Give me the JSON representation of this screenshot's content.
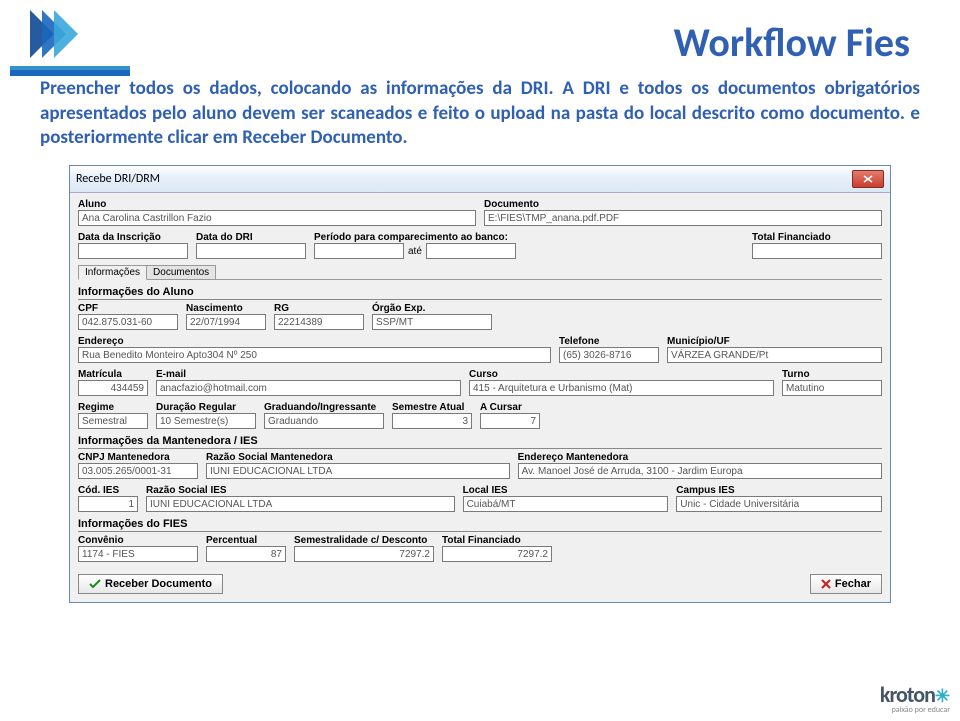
{
  "slide": {
    "title": "Workflow Fies",
    "body_text": "Preencher todos os dados, colocando as informações da DRI. A DRI e todos os documentos obrigatórios apresentados pelo aluno devem ser scaneados e feito o upload na pasta do local descrito como documento. e posteriormente clicar em Receber Documento."
  },
  "window": {
    "title": "Recebe DRI/DRM",
    "close": "X",
    "aluno": {
      "label": "Aluno",
      "value": "Ana Carolina Castrillon Fazio"
    },
    "documento": {
      "label": "Documento",
      "value": "E:\\FIES\\TMP_anana.pdf.PDF"
    },
    "data_inscricao": {
      "label": "Data da Inscrição",
      "value": ""
    },
    "data_dri": {
      "label": "Data do DRI",
      "value": ""
    },
    "periodo": {
      "label": "Período para comparecimento ao banco:",
      "from": "",
      "sep": "até",
      "to": ""
    },
    "total_financiado_top": {
      "label": "Total Financiado",
      "value": ""
    },
    "tabs": [
      "Informações",
      "Documentos"
    ],
    "sec_aluno": {
      "title": "Informações do Aluno",
      "cpf": {
        "label": "CPF",
        "value": "042.875.031-60"
      },
      "nascimento": {
        "label": "Nascimento",
        "value": "22/07/1994"
      },
      "rg": {
        "label": "RG",
        "value": "22214389"
      },
      "orgao": {
        "label": "Órgão Exp.",
        "value": "SSP/MT"
      },
      "endereco": {
        "label": "Endereço",
        "value": "Rua Benedito Monteiro Apto304 Nº 250"
      },
      "telefone": {
        "label": "Telefone",
        "value": "(65) 3026-8716"
      },
      "municipio": {
        "label": "Município/UF",
        "value": "VÁRZEA GRANDE/Pt"
      },
      "matricula": {
        "label": "Matrícula",
        "value": "434459"
      },
      "email": {
        "label": "E-mail",
        "value": "anacfazio@hotmail.com"
      },
      "curso": {
        "label": "Curso",
        "value": "415 - Arquitetura e Urbanismo (Mat)"
      },
      "turno": {
        "label": "Turno",
        "value": "Matutino"
      },
      "regime": {
        "label": "Regime",
        "value": "Semestral"
      },
      "duracao": {
        "label": "Duração Regular",
        "value": "10 Semestre(s)"
      },
      "grad": {
        "label": "Graduando/Ingressante",
        "value": "Graduando"
      },
      "sem_atual": {
        "label": "Semestre Atual",
        "value": "3"
      },
      "a_cursar": {
        "label": "A Cursar",
        "value": "7"
      }
    },
    "sec_mant": {
      "title": "Informações da Mantenedora / IES",
      "cnpj": {
        "label": "CNPJ Mantenedora",
        "value": "03.005.265/0001-31"
      },
      "razao_mant": {
        "label": "Razão Social Mantenedora",
        "value": "IUNI EDUCACIONAL LTDA"
      },
      "end_mant": {
        "label": "Endereço Mantenedora",
        "value": "Av. Manoel José de Arruda, 3100 - Jardim Europa"
      },
      "cod_ies": {
        "label": "Cód. IES",
        "value": "1"
      },
      "razao_ies": {
        "label": "Razão Social IES",
        "value": "IUNI EDUCACIONAL LTDA"
      },
      "local_ies": {
        "label": "Local IES",
        "value": "Cuiabá/MT"
      },
      "campus_ies": {
        "label": "Campus IES",
        "value": "Unic - Cidade Universitária"
      }
    },
    "sec_fies": {
      "title": "Informações do FIES",
      "convenio": {
        "label": "Convênio",
        "value": "1174 - FIES"
      },
      "percentual": {
        "label": "Percentual",
        "value": "87"
      },
      "semestralidade": {
        "label": "Semestralidade c/ Desconto",
        "value": "7297.2"
      },
      "total_fin": {
        "label": "Total Financiado",
        "value": "7297.2"
      }
    },
    "buttons": {
      "receber": "Receber Documento",
      "fechar": "Fechar"
    }
  },
  "footer": {
    "brand": "kroton",
    "tag": "paixão por educar"
  }
}
